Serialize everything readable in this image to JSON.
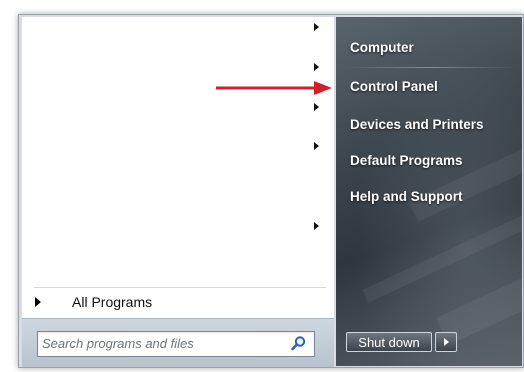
{
  "left_panel": {
    "all_programs_label": "All Programs",
    "search": {
      "placeholder": "Search programs and files",
      "value": ""
    }
  },
  "right_panel": {
    "items": [
      {
        "label": "Computer"
      },
      {
        "label": "Control Panel"
      },
      {
        "label": "Devices and Printers"
      },
      {
        "label": "Default Programs"
      },
      {
        "label": "Help and Support"
      }
    ],
    "shutdown_label": "Shut down"
  },
  "annotation": {
    "color": "#d0202a",
    "points_to": "Control Panel"
  },
  "icons": {
    "search": "search-icon",
    "submenu": "chevron-right-icon",
    "shutdown_options": "chevron-right-icon",
    "annotation": "arrow-right-icon"
  }
}
